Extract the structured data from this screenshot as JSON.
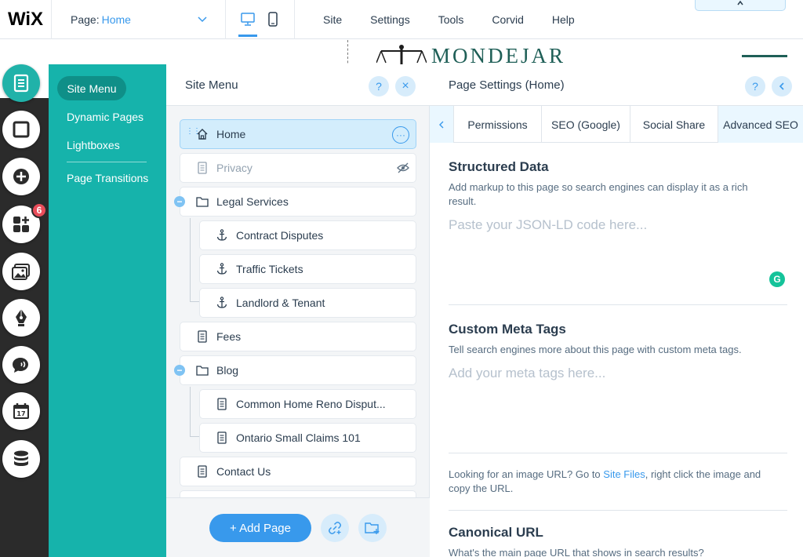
{
  "topbar": {
    "logo": "WiX",
    "page_label": "Page:",
    "page_value": "Home",
    "menu": [
      "Site",
      "Settings",
      "Tools",
      "Corvid",
      "Help"
    ]
  },
  "canvas": {
    "brand": "MONDEJAR"
  },
  "toolbar": {
    "badge_count": "6"
  },
  "teal_menu": {
    "active": "Site Menu",
    "items": [
      "Dynamic Pages",
      "Lightboxes",
      "Page Transitions"
    ]
  },
  "site_menu": {
    "title": "Site Menu",
    "help": "?",
    "close": "×",
    "pages": [
      {
        "label": "Home"
      },
      {
        "label": "Privacy"
      },
      {
        "label": "Legal Services"
      },
      {
        "label": "Contract Disputes"
      },
      {
        "label": "Traffic Tickets"
      },
      {
        "label": "Landlord & Tenant"
      },
      {
        "label": "Fees"
      },
      {
        "label": "Blog"
      },
      {
        "label": "Common Home Reno Disput..."
      },
      {
        "label": "Ontario Small Claims 101"
      },
      {
        "label": "Contact Us"
      }
    ],
    "add_page": "+ Add Page"
  },
  "page_settings": {
    "title": "Page Settings (Home)",
    "help": "?",
    "tabs": [
      "Permissions",
      "SEO (Google)",
      "Social Share",
      "Advanced SEO"
    ],
    "structured": {
      "title": "Structured Data",
      "desc": "Add markup to this page so search engines can display it as a rich result.",
      "placeholder": "Paste your JSON-LD code here..."
    },
    "meta": {
      "title": "Custom Meta Tags",
      "desc": "Tell search engines more about this page with custom meta tags.",
      "placeholder": "Add your meta tags here..."
    },
    "image_hint": {
      "before": "Looking for an image URL? Go to ",
      "link": "Site Files",
      "after": ", right click the image and copy the URL."
    },
    "canonical": {
      "title": "Canonical URL",
      "desc": "What's the main page URL that shows in search results?"
    },
    "grammarly": "G"
  },
  "colors": {
    "accent": "#3899ec",
    "teal": "#16b3ab",
    "badge": "#e94d5a"
  }
}
